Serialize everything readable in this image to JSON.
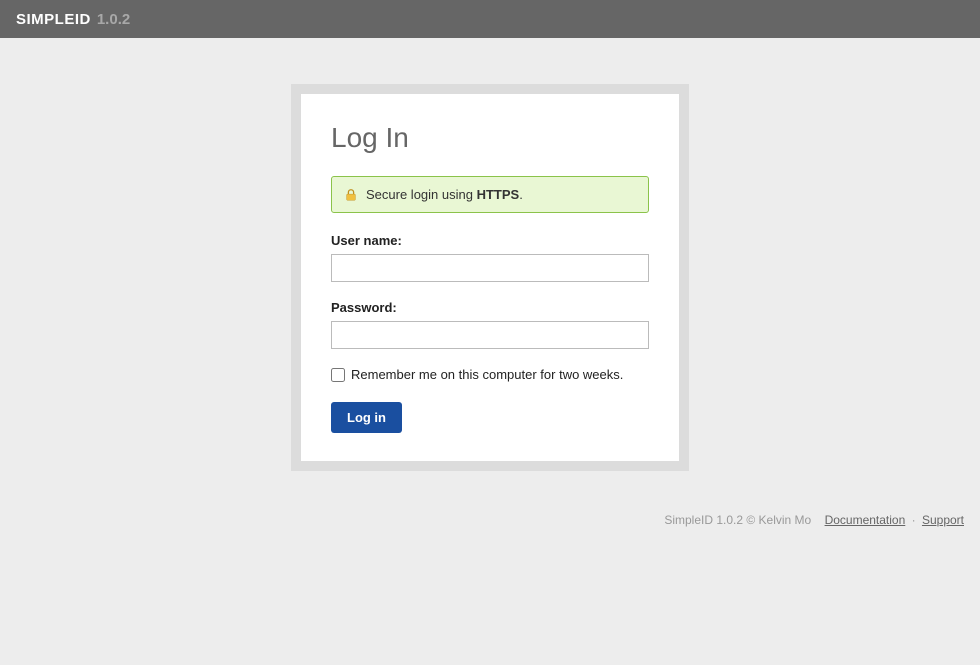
{
  "header": {
    "brand": "SIMPLEID",
    "version": "1.0.2"
  },
  "login": {
    "title": "Log In",
    "secure_prefix": "Secure login using ",
    "secure_strong": "HTTPS",
    "secure_suffix": ".",
    "username_label": "User name:",
    "password_label": "Password:",
    "remember_label": "Remember me on this computer for two weeks.",
    "submit_label": "Log in"
  },
  "footer": {
    "copyright": "SimpleID 1.0.2 © Kelvin Mo",
    "docs": "Documentation",
    "support": "Support"
  }
}
